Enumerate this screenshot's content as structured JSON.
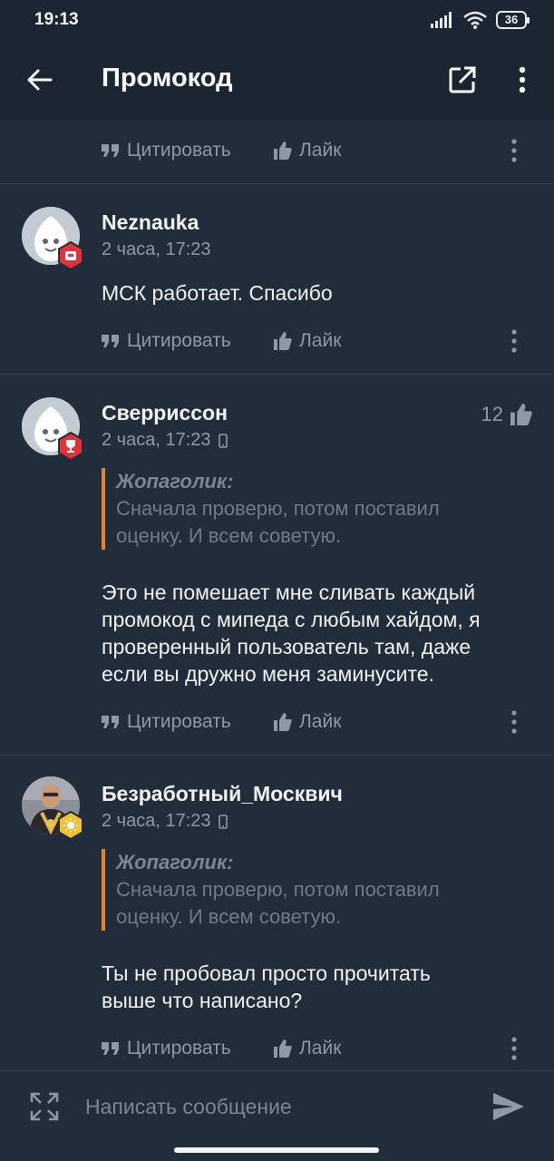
{
  "status_bar": {
    "time": "19:13",
    "battery": "36"
  },
  "header": {
    "title": "Промокод"
  },
  "actions": {
    "quote_label": "Цитировать",
    "like_label": "Лайк"
  },
  "posts": [
    {
      "author": "Neznauka",
      "time": "2 часа, 17:23",
      "text": "МСК работает. Спасибо",
      "badge_color": "#e2323b"
    },
    {
      "author": "Сверриссон",
      "time": "2 часа, 17:23",
      "likes": "12",
      "quote_author": "Жопаголик:",
      "quote_line1": "Сначала проверю, потом поставил",
      "quote_line2": "оценку. И всем советую.",
      "text_line1": "Это не помешает мне сливать каждый",
      "text_line2": "промокод с мипеда с любым хайдом, я",
      "text_line3": "проверенный пользователь там, даже",
      "text_line4": "если вы дружно меня заминусите.",
      "badge_color": "#e2323b"
    },
    {
      "author": "Безработный_Москвич",
      "time": "2 часа, 17:23",
      "quote_author": "Жопаголик:",
      "quote_line1": "Сначала проверю, потом поставил",
      "quote_line2": "оценку. И всем советую.",
      "text_line1": "Ты не пробовал просто прочитать",
      "text_line2": "выше что написано?",
      "badge_color": "#f2c12e"
    }
  ],
  "composer": {
    "placeholder": "Написать сообщение"
  },
  "colors": {
    "background": "#222d3b",
    "appbar": "#1c2633",
    "quote_accent": "#e7852b",
    "muted": "#8e99a8"
  },
  "icons": [
    "back-arrow-icon",
    "open-external-icon",
    "more-vert-icon",
    "quote-icon",
    "thumb-up-icon",
    "device-icon",
    "expand-icon",
    "send-icon"
  ]
}
